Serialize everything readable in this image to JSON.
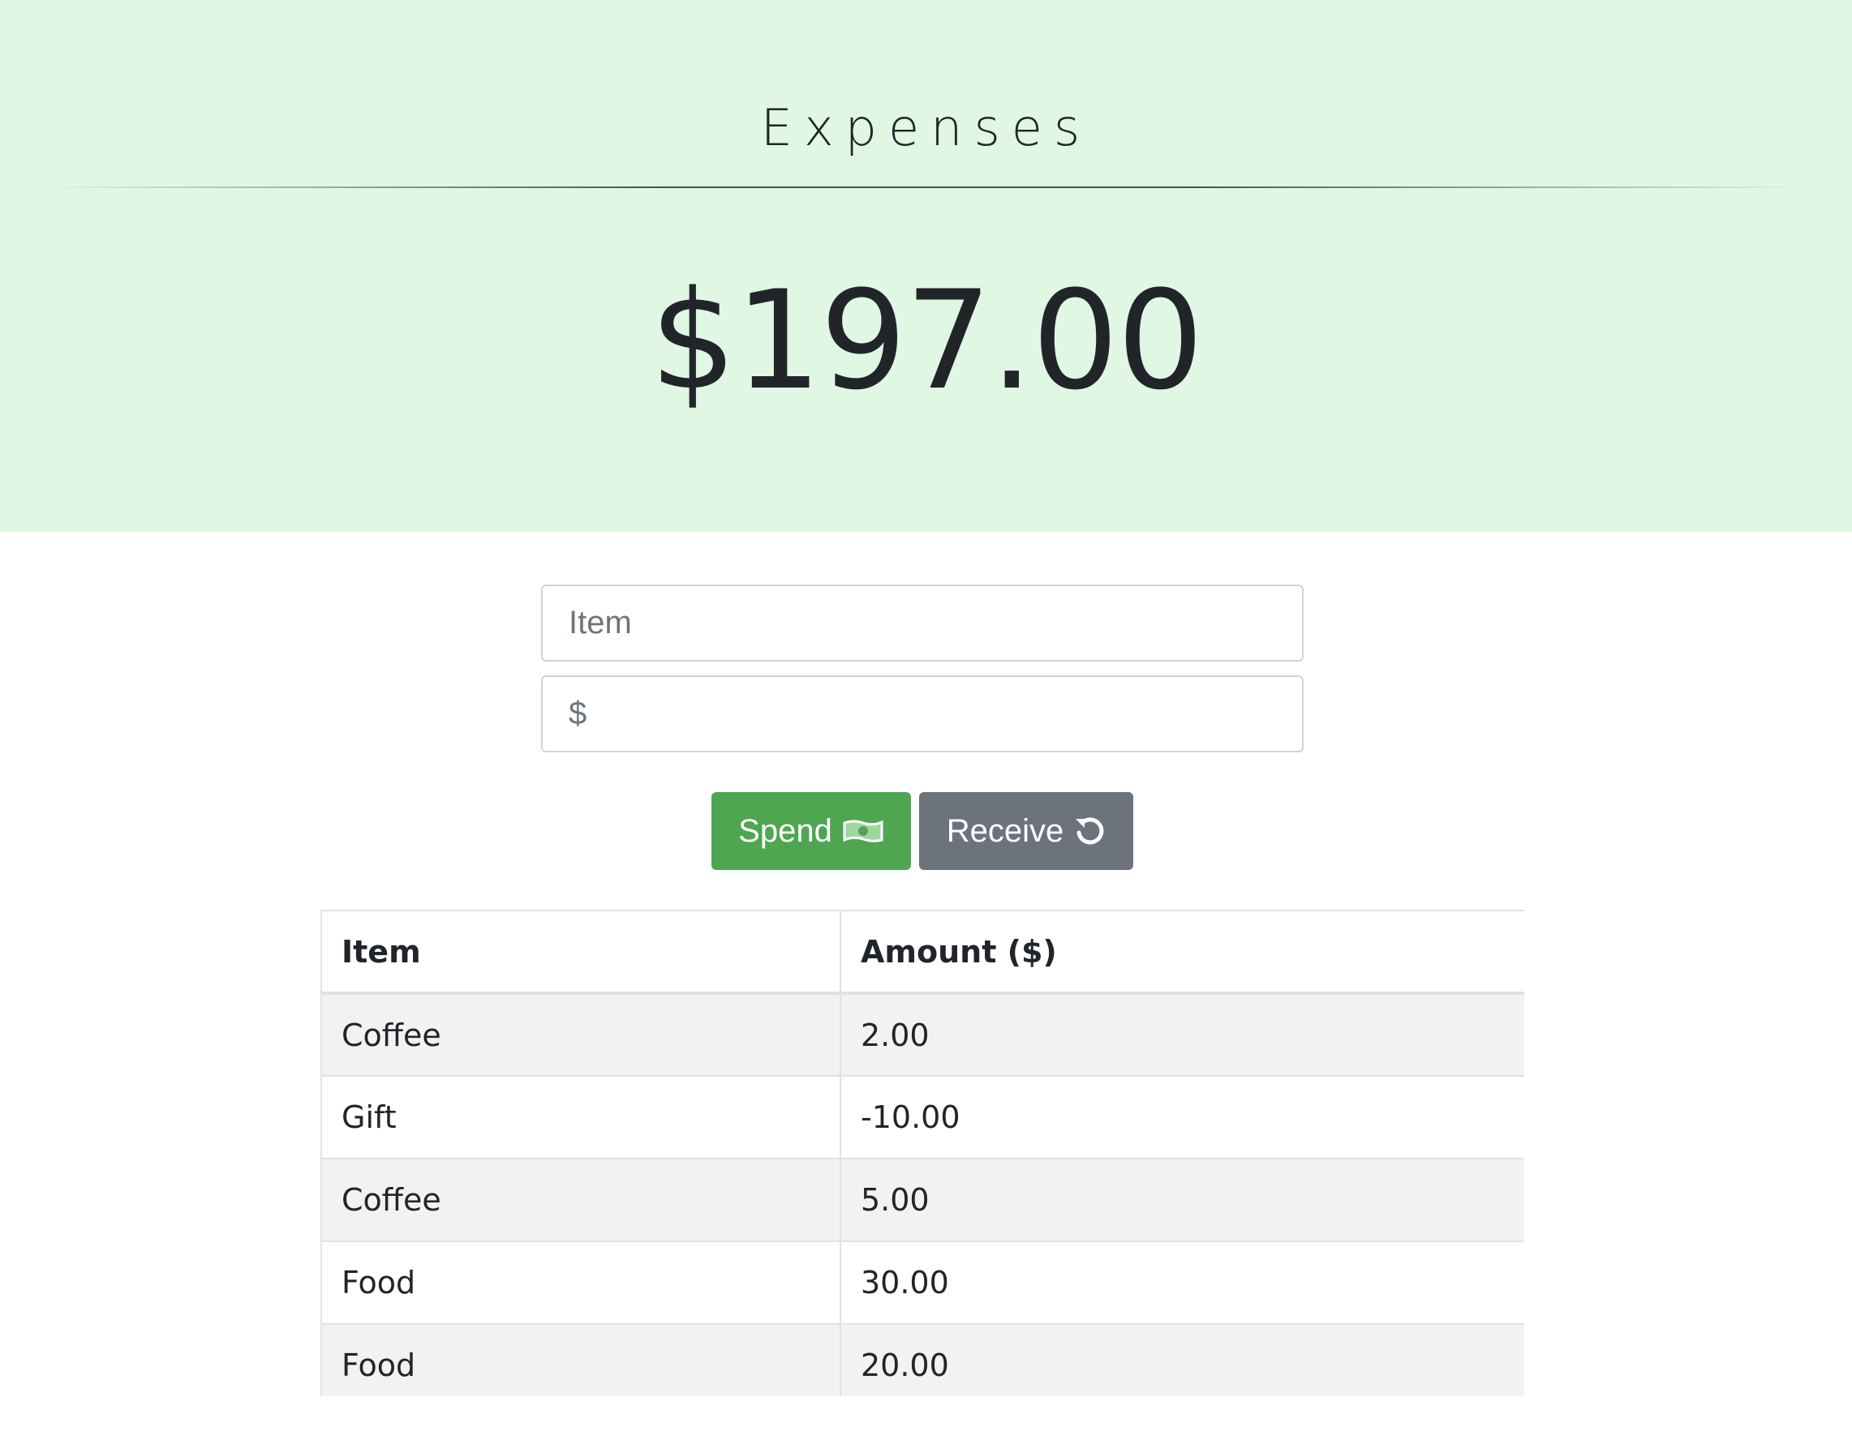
{
  "header": {
    "title": "Expenses",
    "total": "$197.00"
  },
  "form": {
    "item_placeholder": "Item",
    "amount_placeholder": "$",
    "spend_label": "Spend",
    "spend_icon": "money-bill-icon",
    "receive_label": "Receive",
    "receive_icon": "undo-icon"
  },
  "colors": {
    "hero_bg": "#dff7e3",
    "spend_button": "#4ea651",
    "receive_button": "#6c737d"
  },
  "table": {
    "columns": [
      "Item",
      "Amount ($)"
    ],
    "rows": [
      {
        "item": "Coffee",
        "amount": "2.00"
      },
      {
        "item": "Gift",
        "amount": "-10.00"
      },
      {
        "item": "Coffee",
        "amount": "5.00"
      },
      {
        "item": "Food",
        "amount": "30.00"
      },
      {
        "item": "Food",
        "amount": "20.00"
      }
    ]
  }
}
